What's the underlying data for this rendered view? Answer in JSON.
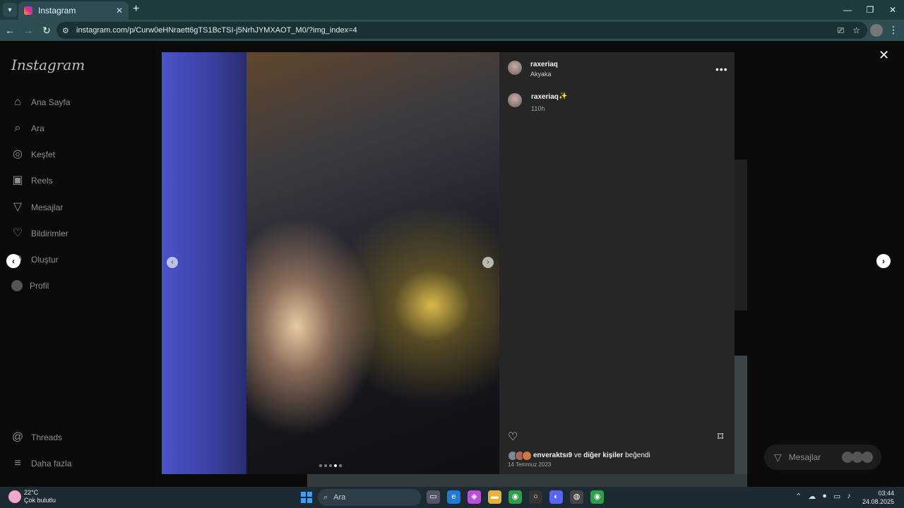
{
  "browser": {
    "tab_title": "Instagram",
    "url": "instagram.com/p/Curw0eHNraett6gTS1BcTSI-j5NrhJYMXAOT_M0/?img_index=4"
  },
  "sidebar": {
    "logo": "Instagram",
    "items": [
      {
        "label": "Ana Sayfa",
        "icon": "home-icon"
      },
      {
        "label": "Ara",
        "icon": "search-icon"
      },
      {
        "label": "Keşfet",
        "icon": "compass-icon"
      },
      {
        "label": "Reels",
        "icon": "reels-icon"
      },
      {
        "label": "Mesajlar",
        "icon": "send-icon"
      },
      {
        "label": "Bildirimler",
        "icon": "heart-icon"
      },
      {
        "label": "Oluştur",
        "icon": "plus-icon"
      },
      {
        "label": "Profil",
        "icon": "avatar"
      }
    ],
    "bottom_items": [
      {
        "label": "Threads",
        "icon": "threads-icon"
      },
      {
        "label": "Daha fazla",
        "icon": "menu-icon"
      }
    ]
  },
  "post": {
    "username": "raxeriaq",
    "location": "Akyaka",
    "caption_user": "raxeriaq",
    "caption_emoji": "✨",
    "caption_time": "110h",
    "likes_user": "enveraktsı9",
    "likes_connector": "ve",
    "likes_others": "diğer kişiler",
    "likes_suffix": "beğendi",
    "date": "14 Temmuz 2023",
    "carousel_count": 5,
    "carousel_active": 4
  },
  "messages_pill": {
    "label": "Mesajlar"
  },
  "taskbar": {
    "weather_temp": "22°C",
    "weather_desc": "Çok bulutlu",
    "search_placeholder": "Ara",
    "time": "03:44",
    "date": "24.08.2025"
  },
  "colors": {
    "ig_bg": "#0b0b0b",
    "panel_bg": "#262626",
    "taskbar_bg": "#1c2a33",
    "chrome_bg": "#2e4d52"
  }
}
